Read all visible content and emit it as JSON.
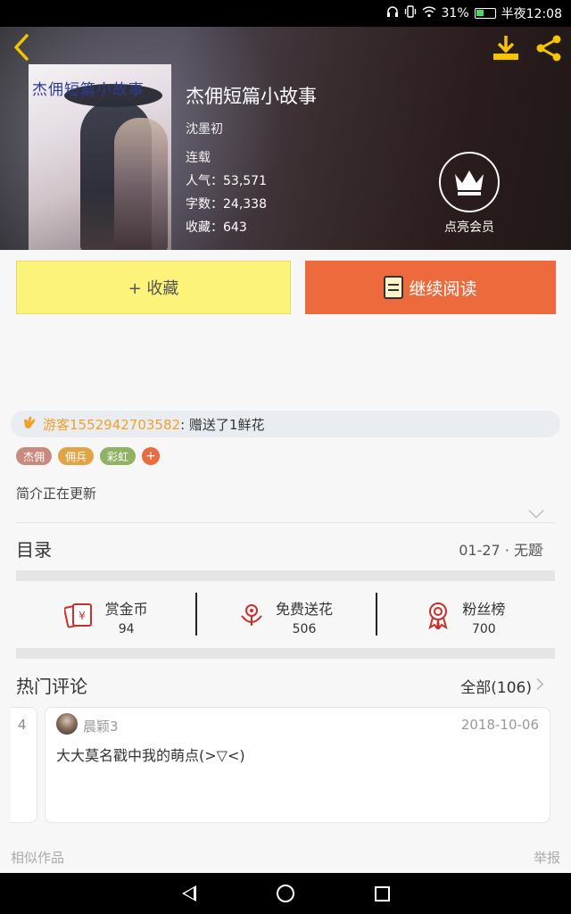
{
  "status_bar": {
    "battery": "31%",
    "time": "半夜12:08"
  },
  "book": {
    "cover_text": "杰佣短篇小故事",
    "title": "杰佣短篇小故事",
    "author": "沈墨初",
    "status": "连载",
    "popularity": "人气：53,571",
    "words": "字数：24,338",
    "favorites": "收藏：643"
  },
  "vip": {
    "label": "点亮会员"
  },
  "actions": {
    "favorite": "+ 收藏",
    "continue_reading": "继续阅读"
  },
  "gift": {
    "user": "游客1552942703582",
    "message": " : 赠送了1鲜花"
  },
  "tags": [
    {
      "label": "杰佣",
      "color": "#c98a7e"
    },
    {
      "label": "佣兵",
      "color": "#e0a445"
    },
    {
      "label": "彩虹",
      "color": "#8fb265"
    }
  ],
  "tag_add": "+",
  "intro": "简介正在更新",
  "toc": {
    "label": "目录",
    "latest": "01-27 · 无题"
  },
  "stats": [
    {
      "name": "赏金币",
      "value": "94",
      "icon": "reward-coin-icon"
    },
    {
      "name": "免费送花",
      "value": "506",
      "icon": "flower-icon"
    },
    {
      "name": "粉丝榜",
      "value": "700",
      "icon": "medal-icon"
    }
  ],
  "comments": {
    "label": "热门评论",
    "all": "全部(106)",
    "prev_card_fragment": "4",
    "items": [
      {
        "user": "晨颖3",
        "date": "2018-10-06",
        "text": "大大莫名戳中我的萌点(>▽<)"
      }
    ]
  },
  "footer": {
    "similar": "相似作品",
    "report": "举报"
  },
  "colors": {
    "accent_orange": "#ec6a3c",
    "favorite_yellow": "#fcf37a",
    "header_icon_yellow": "#f5c400",
    "gift_user": "#f0a12a"
  }
}
